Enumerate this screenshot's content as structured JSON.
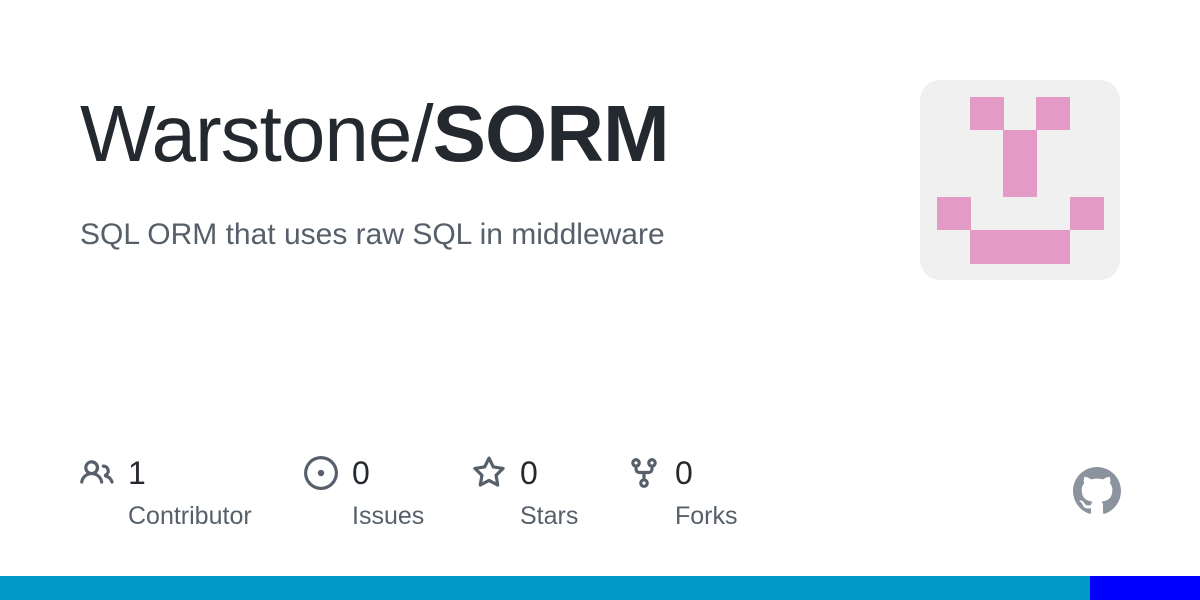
{
  "repo": {
    "owner": "Warstone/",
    "name": "SORM",
    "description": "SQL ORM that uses raw SQL in middleware"
  },
  "avatar": {
    "icon": "identicon-avatar",
    "background": "#f0f0f0",
    "color": "#e39ac4"
  },
  "stats": {
    "contributors": {
      "value": "1",
      "label": "Contributor",
      "icon": "people-icon"
    },
    "issues": {
      "value": "0",
      "label": "Issues",
      "icon": "issue-opened-icon"
    },
    "stars": {
      "value": "0",
      "label": "Stars",
      "icon": "star-icon"
    },
    "forks": {
      "value": "0",
      "label": "Forks",
      "icon": "repo-forked-icon"
    }
  },
  "brand": {
    "icon": "github-mark-icon",
    "color": "#8b949e"
  },
  "language_bar": {
    "colors": [
      "#0099c8",
      "#0000ff"
    ],
    "fractions": [
      0.908,
      0.092
    ]
  }
}
